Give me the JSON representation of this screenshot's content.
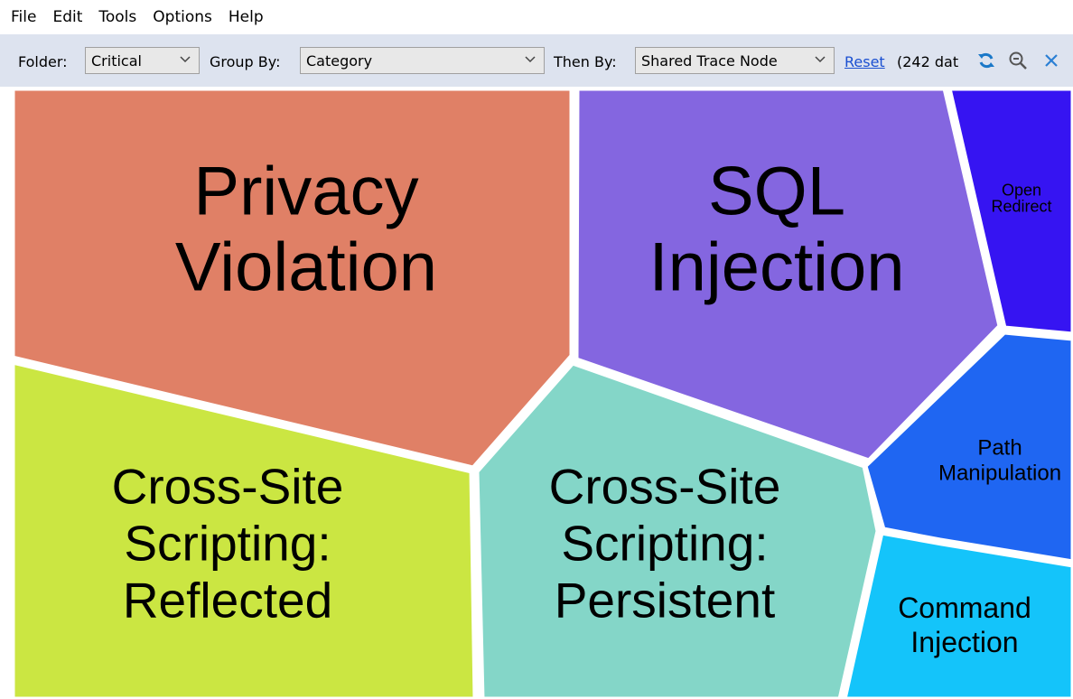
{
  "menu": [
    "File",
    "Edit",
    "Tools",
    "Options",
    "Help"
  ],
  "toolbar": {
    "folder_label": "Folder:",
    "folder_value": "Critical",
    "group_by_label": "Group By:",
    "group_by_value": "Category",
    "then_by_label": "Then By:",
    "then_by_value": "Shared Trace Node",
    "reset_label": "Reset",
    "count_text": "(242 dat",
    "icons": [
      "refresh-icon",
      "zoom-out-icon",
      "close-icon"
    ]
  },
  "chart_data": {
    "type": "voronoi-treemap",
    "cells": [
      {
        "name": "Privacy Violation",
        "lines": [
          "Privacy",
          "Violation"
        ],
        "color": "#e08066"
      },
      {
        "name": "SQL Injection",
        "lines": [
          "SQL",
          "Injection"
        ],
        "color": "#8466e0"
      },
      {
        "name": "Open Redirect",
        "lines": [
          "Open",
          "Redirect"
        ],
        "color": "#3614f2"
      },
      {
        "name": "Path Manipulation",
        "lines": [
          "Path",
          "Manipulation"
        ],
        "color": "#1f66f2"
      },
      {
        "name": "Command Injection",
        "lines": [
          "Command",
          "Injection"
        ],
        "color": "#14c4fa"
      },
      {
        "name": "Cross-Site Scripting: Persistent",
        "lines": [
          "Cross-Site",
          "Scripting:",
          "Persistent"
        ],
        "color": "#84d6c8"
      },
      {
        "name": "Cross-Site Scripting: Reflected",
        "lines": [
          "Cross-Site",
          "Scripting:",
          "Reflected"
        ],
        "color": "#cbe642"
      }
    ]
  }
}
